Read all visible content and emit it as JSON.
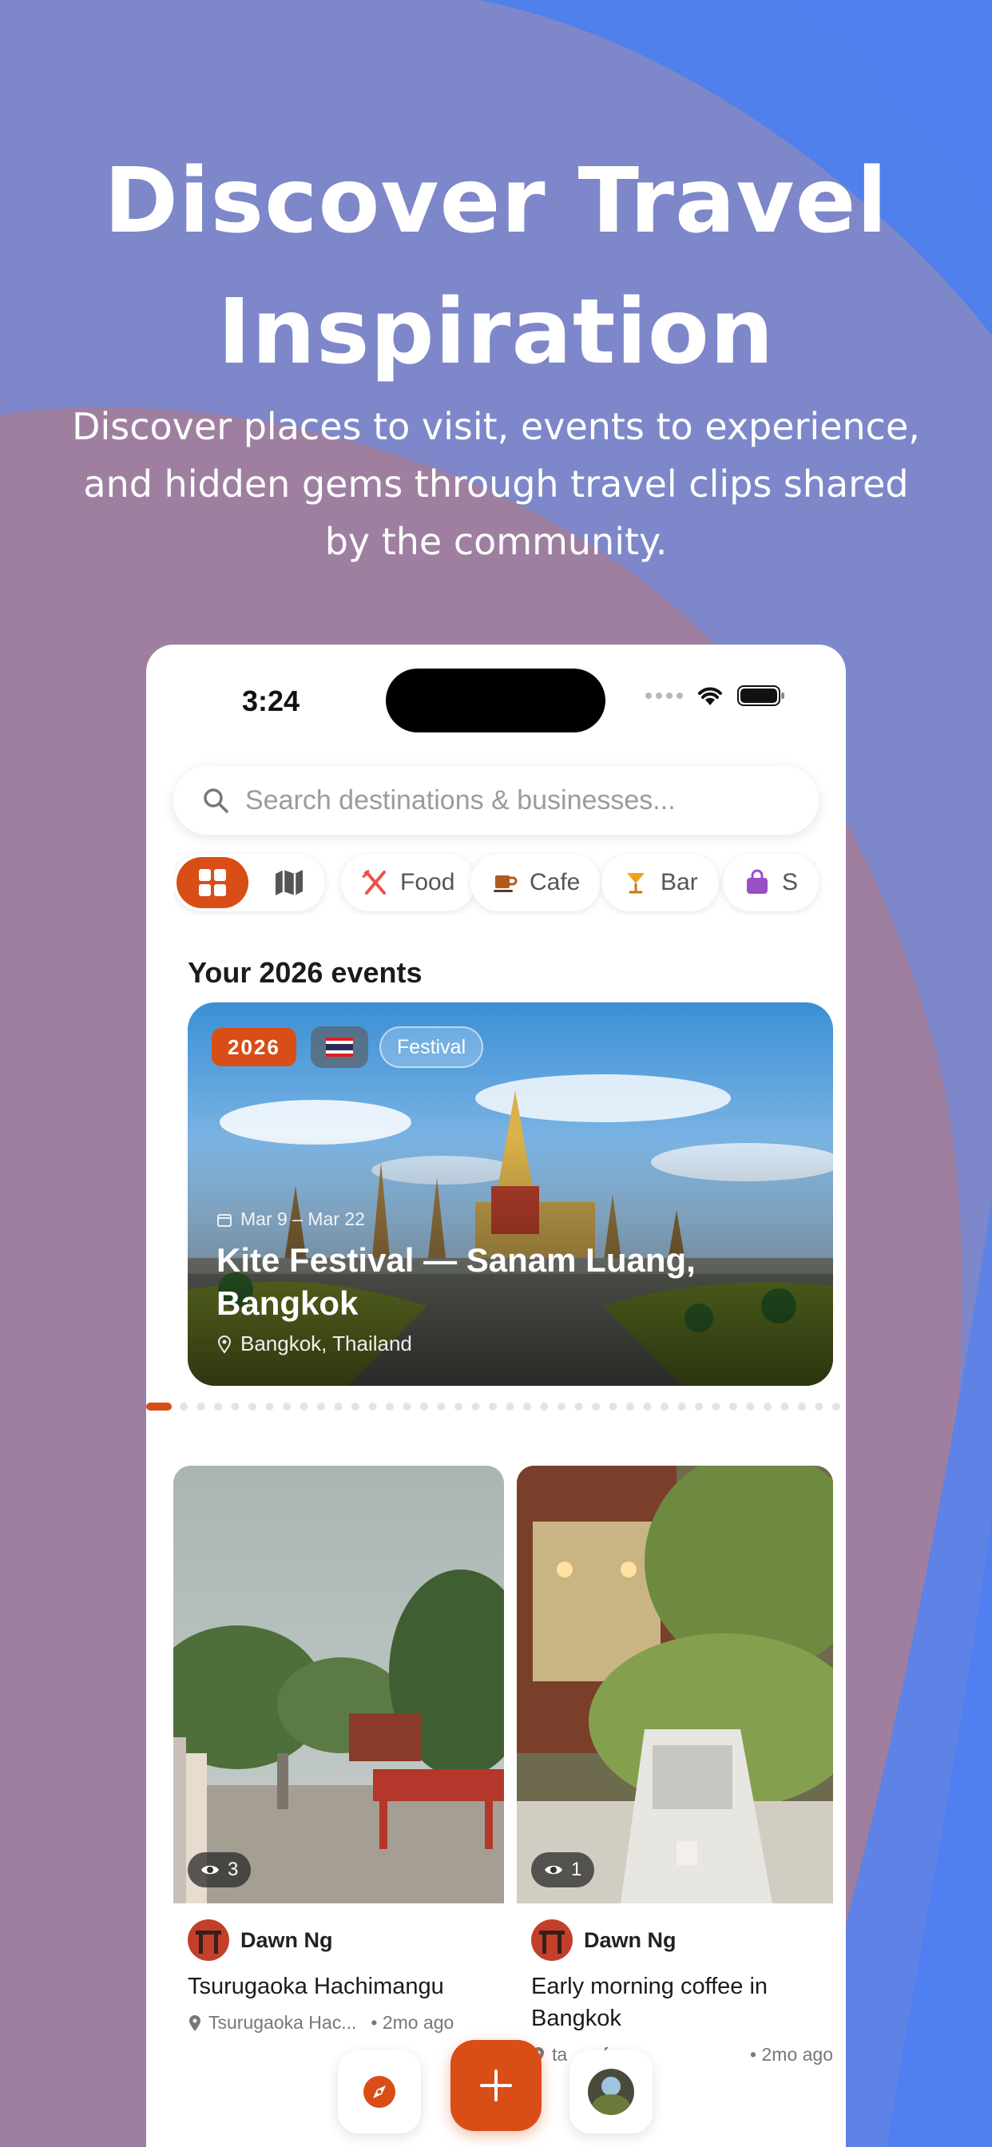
{
  "hero": {
    "title_line1": "Discover Travel",
    "title_line2": "Inspiration",
    "subtitle_line1": "Discover places to visit, events to experience,",
    "subtitle_line2": "and hidden gems through travel clips shared",
    "subtitle_line3": "by the community."
  },
  "status_bar": {
    "time": "3:24"
  },
  "search": {
    "placeholder": "Search destinations & businesses..."
  },
  "categories": [
    {
      "label": "Food",
      "icon": "fork-knife-icon"
    },
    {
      "label": "Cafe",
      "icon": "coffee-cup-icon"
    },
    {
      "label": "Bar",
      "icon": "cocktail-icon"
    },
    {
      "label": "S",
      "icon": "shopping-bag-icon"
    }
  ],
  "events_section": {
    "title": "Your 2026 events",
    "featured": {
      "year_badge": "2026",
      "country_flag": "Thailand flag",
      "category": "Festival",
      "date_range": "Mar 9 – Mar 22",
      "title": "Kite Festival — Sanam Luang, Bangkok",
      "location": "Bangkok, Thailand"
    },
    "page_count": 40,
    "active_page": 1
  },
  "clips": [
    {
      "views": "3",
      "author": "Dawn Ng",
      "title": "Tsurugaoka Hachimangu",
      "place": "Tsurugaoka Hac...",
      "age": "• 2mo ago"
    },
    {
      "views": "1",
      "author": "Dawn Ng",
      "title": "Early morning coffee in Bangkok",
      "place": "ta       fee",
      "age": "• 2mo ago"
    }
  ],
  "colors": {
    "accent": "#d84e16",
    "bg_periwinkle": "#7d87c9",
    "bg_blue": "#4f80eb",
    "bg_mauve": "#9f7fa0"
  },
  "icons": {
    "search": "search-icon",
    "grid_view": "grid-icon",
    "map_view": "map-icon",
    "explore": "compass-icon",
    "add": "plus-icon",
    "profile": "avatar"
  }
}
